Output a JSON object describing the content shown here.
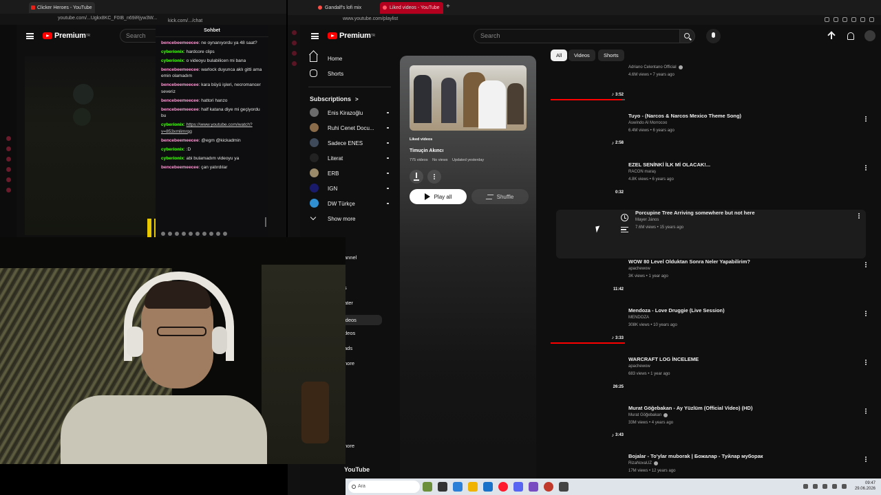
{
  "left_browser": {
    "tab_title": "Clicker Heroes - YouTube",
    "url": "youtube.com/...Ugkx8KC_F0IB_n69iRjyw3W...",
    "search_placeholder": "Search",
    "logo_text": "Premium",
    "logo_sup": "TR"
  },
  "chat": {
    "url": "kick.com/.../chat",
    "title": "Sohbet",
    "messages": [
      {
        "user": "bencebeemeecee",
        "sep": ": ",
        "text": "ne oynanıyordu ya 48 saat?",
        "style": "u1"
      },
      {
        "user": "cyberionix",
        "sep": ": ",
        "text": "hardcore clips",
        "style": "u2"
      },
      {
        "user": "cyberionix",
        "sep": ": ",
        "text": "o videoyu bulabilicen mi bana",
        "style": "u2"
      },
      {
        "user": "bencebeemeecee",
        "sep": ": ",
        "text": "warlock duyunca aklı gitti ama emin olamadım",
        "style": "u1"
      },
      {
        "user": "bencebeemeecee",
        "sep": ": ",
        "text": "kara büyü işleri, necromancer severiz",
        "style": "u1"
      },
      {
        "user": "bencebeemeecee",
        "sep": ": ",
        "text": "hattori hanzo",
        "style": "u1"
      },
      {
        "user": "bencebeemeecee",
        "sep": ": ",
        "text": "half katana diye mi geçiyordu bu",
        "style": "u1"
      },
      {
        "user": "cyberionix",
        "sep": ": ",
        "text": "https://www.youtube.com/watch?v=853xmlimrqg",
        "style": "u2",
        "link": true
      },
      {
        "user": "bencebeemeecee",
        "sep": ": ",
        "text": "@egm @kickadmin",
        "style": "u1"
      },
      {
        "user": "cyberionix",
        "sep": ": ",
        "text": ":D",
        "style": "u2"
      },
      {
        "user": "cyberionix",
        "sep": ": ",
        "text": "abi bulamadım videoyu ya",
        "style": "u2"
      },
      {
        "user": "bencebeemeecee",
        "sep": ": ",
        "text": "çan yatırdılar",
        "style": "u1"
      }
    ]
  },
  "right_browser": {
    "tabs": [
      {
        "label": "Gandalf's lofi mix"
      },
      {
        "label": "Liked videos - YouTube"
      }
    ],
    "url": "www.youtube.com/playlist"
  },
  "yt": {
    "logo_text": "Premium",
    "logo_sup": "TR",
    "search_placeholder": "Search",
    "sidebar": {
      "home": "Home",
      "shorts": "Shorts",
      "subscriptions": "Subscriptions",
      "subscriptions_chevron": ">",
      "subs": [
        {
          "name": "Enis Kirazoğlu",
          "color": "#6b6b6b"
        },
        {
          "name": "Ruhi Cenet Docu...",
          "color": "#8a6b4a"
        },
        {
          "name": "Sadece ENES",
          "color": "#3e4a5a"
        },
        {
          "name": "Literat",
          "color": "#222222"
        },
        {
          "name": "ERB",
          "color": "#9a8a6a"
        },
        {
          "name": "IGN",
          "color": "#1a1a6a"
        },
        {
          "name": "DW Türkçe",
          "color": "#2f8fd0"
        }
      ],
      "show_more": "Show more"
    },
    "playlist": {
      "label": "Liked videos",
      "owner": "Timuçin Akıncı",
      "videos": "775 videos",
      "views": "No views",
      "updated": "Updated yesterday",
      "play_all": "Play all",
      "shuffle": "Shuffle"
    },
    "chips": [
      {
        "label": "All",
        "active": true
      },
      {
        "label": "Videos",
        "active": false
      },
      {
        "label": "Shorts",
        "active": false
      }
    ],
    "videos": [
      {
        "title": "",
        "channel": "Adriano Celentano Official",
        "verified": true,
        "meta": "4.6M views • 7 years ago",
        "duration": "3:52",
        "music": true,
        "progress": 0.95
      },
      {
        "title": "Tuyo - (Narcos & Narcos Mexico Theme Song)",
        "channel": "Aswindo Al Morrocoo",
        "verified": false,
        "meta": "6.4M views • 6 years ago",
        "duration": "2:58",
        "music": true,
        "progress": 0
      },
      {
        "title": "EZEL SENİNKİ İLK Mİ OLACAK!...",
        "channel": "RACON maraş",
        "verified": false,
        "meta": "4.8K views • 6 years ago",
        "duration": "0:32",
        "music": false,
        "progress": 0
      },
      {
        "title": "Porcupine Tree   Arriving somewhere but not here",
        "channel": "Mayer János",
        "verified": false,
        "meta": "7.6M views • 15 years ago",
        "duration": "",
        "music": false,
        "progress": 0,
        "hover": true
      },
      {
        "title": "WOW 80 Level Olduktan Sonra Neler Yapabilirim?",
        "channel": "apachewow",
        "verified": false,
        "meta": "3K views • 1 year ago",
        "duration": "11:42",
        "music": false,
        "progress": 0
      },
      {
        "title": "Mendoza - Love Druggie (Live Session)",
        "channel": "MENDOZA",
        "verified": false,
        "meta": "308K views • 10 years ago",
        "duration": "3:33",
        "music": true,
        "progress": 1
      },
      {
        "title": "WARCRAFT LOG İNCELEME",
        "channel": "apachewow",
        "verified": false,
        "meta": "683 views • 1 year ago",
        "duration": "26:25",
        "music": false,
        "progress": 0
      },
      {
        "title": "Murat Göğebakan - Ay Yüzlüm (Official Video) (HD)",
        "channel": "Murat Göğebakan",
        "verified": true,
        "meta": "33M views • 4 years ago",
        "duration": "3:43",
        "music": true,
        "progress": 0
      },
      {
        "title": "Bojalar - To'ylar muborak | Божалар - Туйлар муборак",
        "channel": "RizaNovaUZ",
        "verified": true,
        "meta": "17M views • 12 years ago",
        "duration": "",
        "music": false,
        "progress": 0
      }
    ]
  },
  "sidebar_fragments": [
    {
      "text": "annel"
    },
    {
      "text": "s"
    },
    {
      "text": "ater"
    },
    {
      "text": "ideos",
      "active": true
    },
    {
      "text": "deos"
    },
    {
      "text": "ads"
    },
    {
      "text": "nore"
    },
    {
      "text": "nore"
    },
    {
      "text": "YouTube"
    }
  ],
  "taskbar": {
    "search_placeholder": "Ara",
    "time": "09:47",
    "date": "29.06.2026"
  },
  "colors": {
    "accent": "#ff0000",
    "tab_active": "#b3001e",
    "chat_user_pink": "#ff9ad5",
    "chat_user_green": "#53fc18"
  }
}
